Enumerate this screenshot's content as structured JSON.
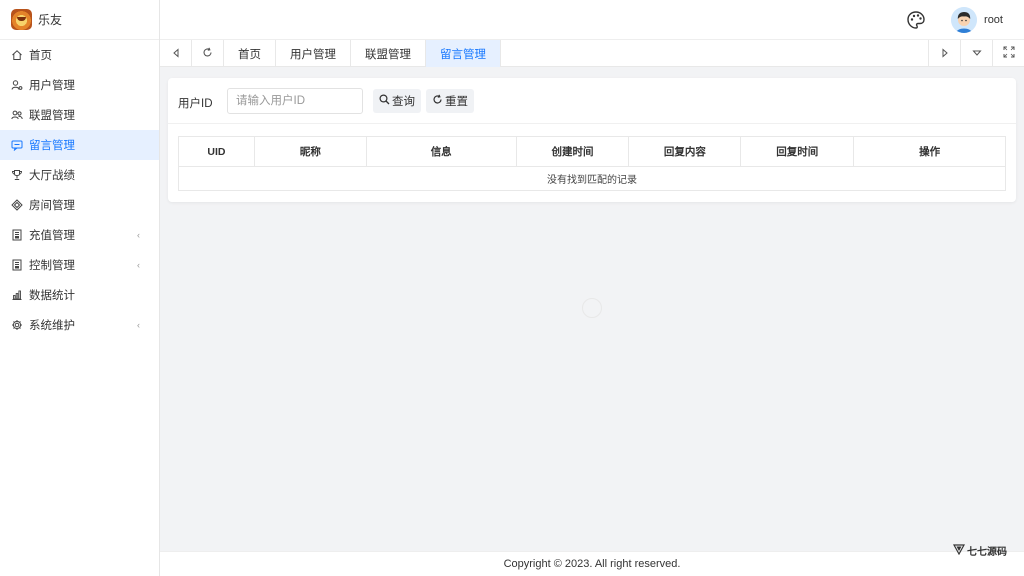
{
  "app": {
    "name": "乐友"
  },
  "sidebar": {
    "items": [
      {
        "label": "首页",
        "icon": "home-icon",
        "active": false,
        "expandable": false
      },
      {
        "label": "用户管理",
        "icon": "user-icon",
        "active": false,
        "expandable": false
      },
      {
        "label": "联盟管理",
        "icon": "users-icon",
        "active": false,
        "expandable": false
      },
      {
        "label": "留言管理",
        "icon": "message-icon",
        "active": true,
        "expandable": false
      },
      {
        "label": "大厅战绩",
        "icon": "trophy-icon",
        "active": false,
        "expandable": false
      },
      {
        "label": "房间管理",
        "icon": "room-icon",
        "active": false,
        "expandable": false
      },
      {
        "label": "充值管理",
        "icon": "recharge-icon",
        "active": false,
        "expandable": true
      },
      {
        "label": "控制管理",
        "icon": "control-icon",
        "active": false,
        "expandable": true
      },
      {
        "label": "数据统计",
        "icon": "stats-icon",
        "active": false,
        "expandable": false
      },
      {
        "label": "系统维护",
        "icon": "settings-icon",
        "active": false,
        "expandable": true
      }
    ]
  },
  "header": {
    "username": "root"
  },
  "tabs": [
    {
      "label": "首页",
      "active": false
    },
    {
      "label": "用户管理",
      "active": false
    },
    {
      "label": "联盟管理",
      "active": false
    },
    {
      "label": "留言管理",
      "active": true
    }
  ],
  "search": {
    "label": "用户ID",
    "placeholder": "请输入用户ID",
    "value": "",
    "query_label": "查询",
    "reset_label": "重置"
  },
  "table": {
    "columns": [
      "UID",
      "昵称",
      "信息",
      "创建时间",
      "回复内容",
      "回复时间",
      "操作"
    ],
    "empty_text": "没有找到匹配的记录"
  },
  "footer": {
    "copyright": "Copyright © 2023. All right reserved."
  },
  "watermark": {
    "text": "七七源码"
  },
  "colors": {
    "accent": "#1677ff",
    "active_bg": "#e6f0ff",
    "page_bg": "#f2f3f5"
  }
}
